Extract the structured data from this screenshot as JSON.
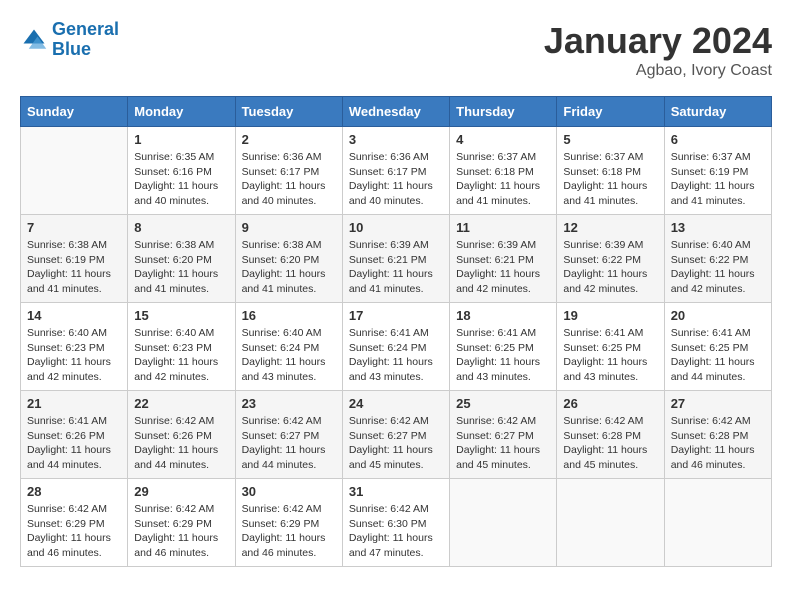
{
  "header": {
    "logo_line1": "General",
    "logo_line2": "Blue",
    "month": "January 2024",
    "location": "Agbao, Ivory Coast"
  },
  "weekdays": [
    "Sunday",
    "Monday",
    "Tuesday",
    "Wednesday",
    "Thursday",
    "Friday",
    "Saturday"
  ],
  "weeks": [
    [
      {
        "day": "",
        "info": ""
      },
      {
        "day": "1",
        "info": "Sunrise: 6:35 AM\nSunset: 6:16 PM\nDaylight: 11 hours\nand 40 minutes."
      },
      {
        "day": "2",
        "info": "Sunrise: 6:36 AM\nSunset: 6:17 PM\nDaylight: 11 hours\nand 40 minutes."
      },
      {
        "day": "3",
        "info": "Sunrise: 6:36 AM\nSunset: 6:17 PM\nDaylight: 11 hours\nand 40 minutes."
      },
      {
        "day": "4",
        "info": "Sunrise: 6:37 AM\nSunset: 6:18 PM\nDaylight: 11 hours\nand 41 minutes."
      },
      {
        "day": "5",
        "info": "Sunrise: 6:37 AM\nSunset: 6:18 PM\nDaylight: 11 hours\nand 41 minutes."
      },
      {
        "day": "6",
        "info": "Sunrise: 6:37 AM\nSunset: 6:19 PM\nDaylight: 11 hours\nand 41 minutes."
      }
    ],
    [
      {
        "day": "7",
        "info": "Sunrise: 6:38 AM\nSunset: 6:19 PM\nDaylight: 11 hours\nand 41 minutes."
      },
      {
        "day": "8",
        "info": "Sunrise: 6:38 AM\nSunset: 6:20 PM\nDaylight: 11 hours\nand 41 minutes."
      },
      {
        "day": "9",
        "info": "Sunrise: 6:38 AM\nSunset: 6:20 PM\nDaylight: 11 hours\nand 41 minutes."
      },
      {
        "day": "10",
        "info": "Sunrise: 6:39 AM\nSunset: 6:21 PM\nDaylight: 11 hours\nand 41 minutes."
      },
      {
        "day": "11",
        "info": "Sunrise: 6:39 AM\nSunset: 6:21 PM\nDaylight: 11 hours\nand 42 minutes."
      },
      {
        "day": "12",
        "info": "Sunrise: 6:39 AM\nSunset: 6:22 PM\nDaylight: 11 hours\nand 42 minutes."
      },
      {
        "day": "13",
        "info": "Sunrise: 6:40 AM\nSunset: 6:22 PM\nDaylight: 11 hours\nand 42 minutes."
      }
    ],
    [
      {
        "day": "14",
        "info": "Sunrise: 6:40 AM\nSunset: 6:23 PM\nDaylight: 11 hours\nand 42 minutes."
      },
      {
        "day": "15",
        "info": "Sunrise: 6:40 AM\nSunset: 6:23 PM\nDaylight: 11 hours\nand 42 minutes."
      },
      {
        "day": "16",
        "info": "Sunrise: 6:40 AM\nSunset: 6:24 PM\nDaylight: 11 hours\nand 43 minutes."
      },
      {
        "day": "17",
        "info": "Sunrise: 6:41 AM\nSunset: 6:24 PM\nDaylight: 11 hours\nand 43 minutes."
      },
      {
        "day": "18",
        "info": "Sunrise: 6:41 AM\nSunset: 6:25 PM\nDaylight: 11 hours\nand 43 minutes."
      },
      {
        "day": "19",
        "info": "Sunrise: 6:41 AM\nSunset: 6:25 PM\nDaylight: 11 hours\nand 43 minutes."
      },
      {
        "day": "20",
        "info": "Sunrise: 6:41 AM\nSunset: 6:25 PM\nDaylight: 11 hours\nand 44 minutes."
      }
    ],
    [
      {
        "day": "21",
        "info": "Sunrise: 6:41 AM\nSunset: 6:26 PM\nDaylight: 11 hours\nand 44 minutes."
      },
      {
        "day": "22",
        "info": "Sunrise: 6:42 AM\nSunset: 6:26 PM\nDaylight: 11 hours\nand 44 minutes."
      },
      {
        "day": "23",
        "info": "Sunrise: 6:42 AM\nSunset: 6:27 PM\nDaylight: 11 hours\nand 44 minutes."
      },
      {
        "day": "24",
        "info": "Sunrise: 6:42 AM\nSunset: 6:27 PM\nDaylight: 11 hours\nand 45 minutes."
      },
      {
        "day": "25",
        "info": "Sunrise: 6:42 AM\nSunset: 6:27 PM\nDaylight: 11 hours\nand 45 minutes."
      },
      {
        "day": "26",
        "info": "Sunrise: 6:42 AM\nSunset: 6:28 PM\nDaylight: 11 hours\nand 45 minutes."
      },
      {
        "day": "27",
        "info": "Sunrise: 6:42 AM\nSunset: 6:28 PM\nDaylight: 11 hours\nand 46 minutes."
      }
    ],
    [
      {
        "day": "28",
        "info": "Sunrise: 6:42 AM\nSunset: 6:29 PM\nDaylight: 11 hours\nand 46 minutes."
      },
      {
        "day": "29",
        "info": "Sunrise: 6:42 AM\nSunset: 6:29 PM\nDaylight: 11 hours\nand 46 minutes."
      },
      {
        "day": "30",
        "info": "Sunrise: 6:42 AM\nSunset: 6:29 PM\nDaylight: 11 hours\nand 46 minutes."
      },
      {
        "day": "31",
        "info": "Sunrise: 6:42 AM\nSunset: 6:30 PM\nDaylight: 11 hours\nand 47 minutes."
      },
      {
        "day": "",
        "info": ""
      },
      {
        "day": "",
        "info": ""
      },
      {
        "day": "",
        "info": ""
      }
    ]
  ]
}
